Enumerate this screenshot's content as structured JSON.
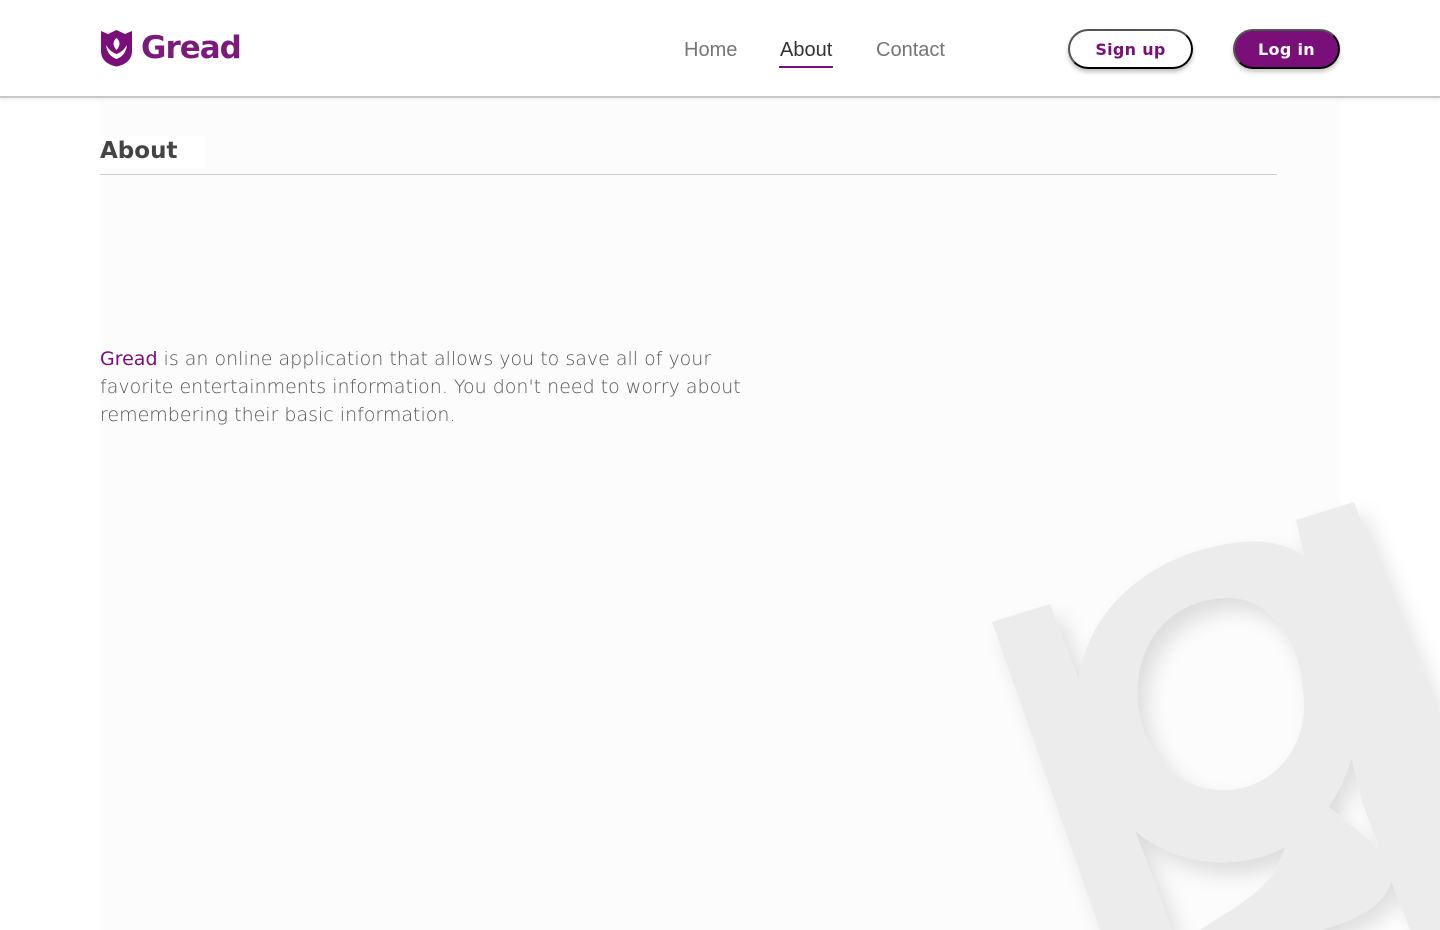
{
  "header": {
    "brand": "Gread",
    "nav": {
      "home": "Home",
      "about": "About",
      "contact": "Contact"
    },
    "signup_label": "Sign up",
    "login_label": "Log in",
    "active_tab": "About"
  },
  "main": {
    "title": "About",
    "brand_name": "Gread",
    "description": " is an online application that allows you to save all of your favorite entertainments information. You don't need to worry about remembering their basic information."
  },
  "colors": {
    "accent": "#7a0f7a",
    "text": "#555555",
    "nav_inactive": "#757575",
    "background_logo": "#ececec"
  },
  "icons": {
    "logo": "shield-leaf-icon",
    "background": "gread-g-watermark"
  }
}
